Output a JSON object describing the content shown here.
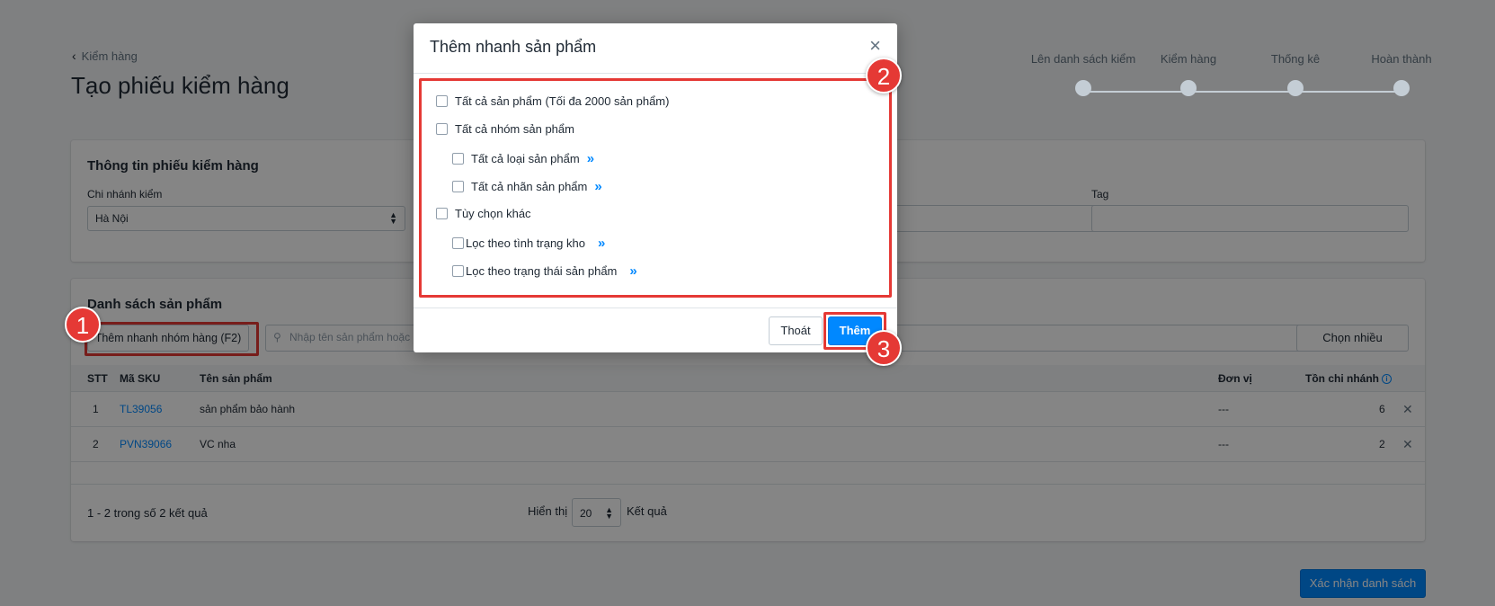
{
  "header": {
    "back_label": "Kiểm hàng",
    "title": "Tạo phiếu kiểm hàng"
  },
  "stepper": {
    "steps": [
      "Lên danh sách kiểm",
      "Kiểm hàng",
      "Thống kê",
      "Hoàn thành"
    ]
  },
  "info_card": {
    "title": "Thông tin phiếu kiểm hàng",
    "branch_label": "Chi nhánh kiểm",
    "branch_value": "Hà Nội",
    "tag_label": "Tag"
  },
  "product_card": {
    "title": "Danh sách sản phẩm",
    "quick_add_button": "Thêm nhanh nhóm hàng (F2)",
    "search_placeholder": "Nhập tên sản phẩm hoặc m",
    "multi_select_button": "Chọn nhiều",
    "columns": {
      "stt": "STT",
      "sku": "Mã SKU",
      "name": "Tên sản phẩm",
      "unit": "Đơn vị",
      "stock": "Tồn chi nhánh"
    },
    "rows": [
      {
        "stt": "1",
        "sku": "TL39056",
        "name": "sản phẩm bảo hành",
        "unit": "---",
        "stock": "6"
      },
      {
        "stt": "2",
        "sku": "PVN39066",
        "name": "VC nha",
        "unit": "---",
        "stock": "2"
      }
    ],
    "pagination": {
      "summary": "1 - 2 trong số 2 kết quả",
      "show_label": "Hiển thị",
      "page_size": "20",
      "results_label": "Kết quả"
    }
  },
  "confirm_button": "Xác nhận danh sách",
  "modal": {
    "title": "Thêm nhanh sản phẩm",
    "options": {
      "all_products": "Tất cả sản phẩm (Tối đa 2000 sản phẩm)",
      "all_groups": "Tất cả nhóm sản phẩm",
      "all_types": "Tất cả loại sản phẩm",
      "all_brands": "Tất cả nhãn sản phẩm",
      "other": "Tùy chọn khác",
      "filter_stock": "Lọc theo tình trạng kho",
      "filter_status": "Lọc theo trạng thái sản phẩm"
    },
    "cancel_button": "Thoát",
    "add_button": "Thêm"
  },
  "annotations": {
    "badge_1": "1",
    "badge_2": "2",
    "badge_3": "3",
    "highlight_color": "#e53935"
  }
}
